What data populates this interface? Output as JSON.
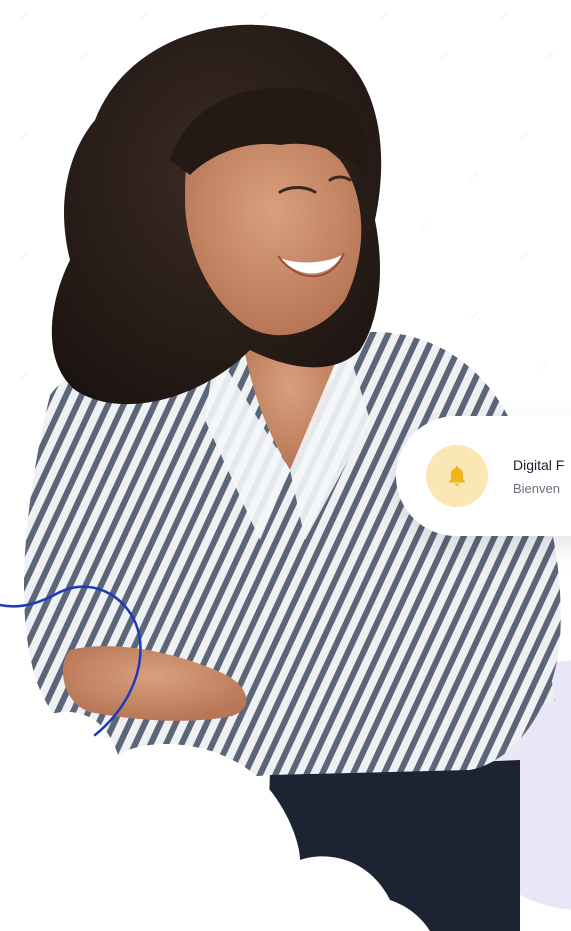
{
  "notification": {
    "title": "Digital F",
    "subtitle": "Bienven",
    "icon": "bell-icon"
  },
  "colors": {
    "background": "#ffffff",
    "bell_badge_bg": "#fbe7b4",
    "bell_icon": "#f0b41d",
    "accent_line": "#1e3ab8",
    "lavender_shape": "#e8e6f7",
    "card_text": "#1f1f2e",
    "card_subtext": "#6a6f7b"
  },
  "illustration": {
    "subject": "woman-smiling-arms-crossed"
  }
}
